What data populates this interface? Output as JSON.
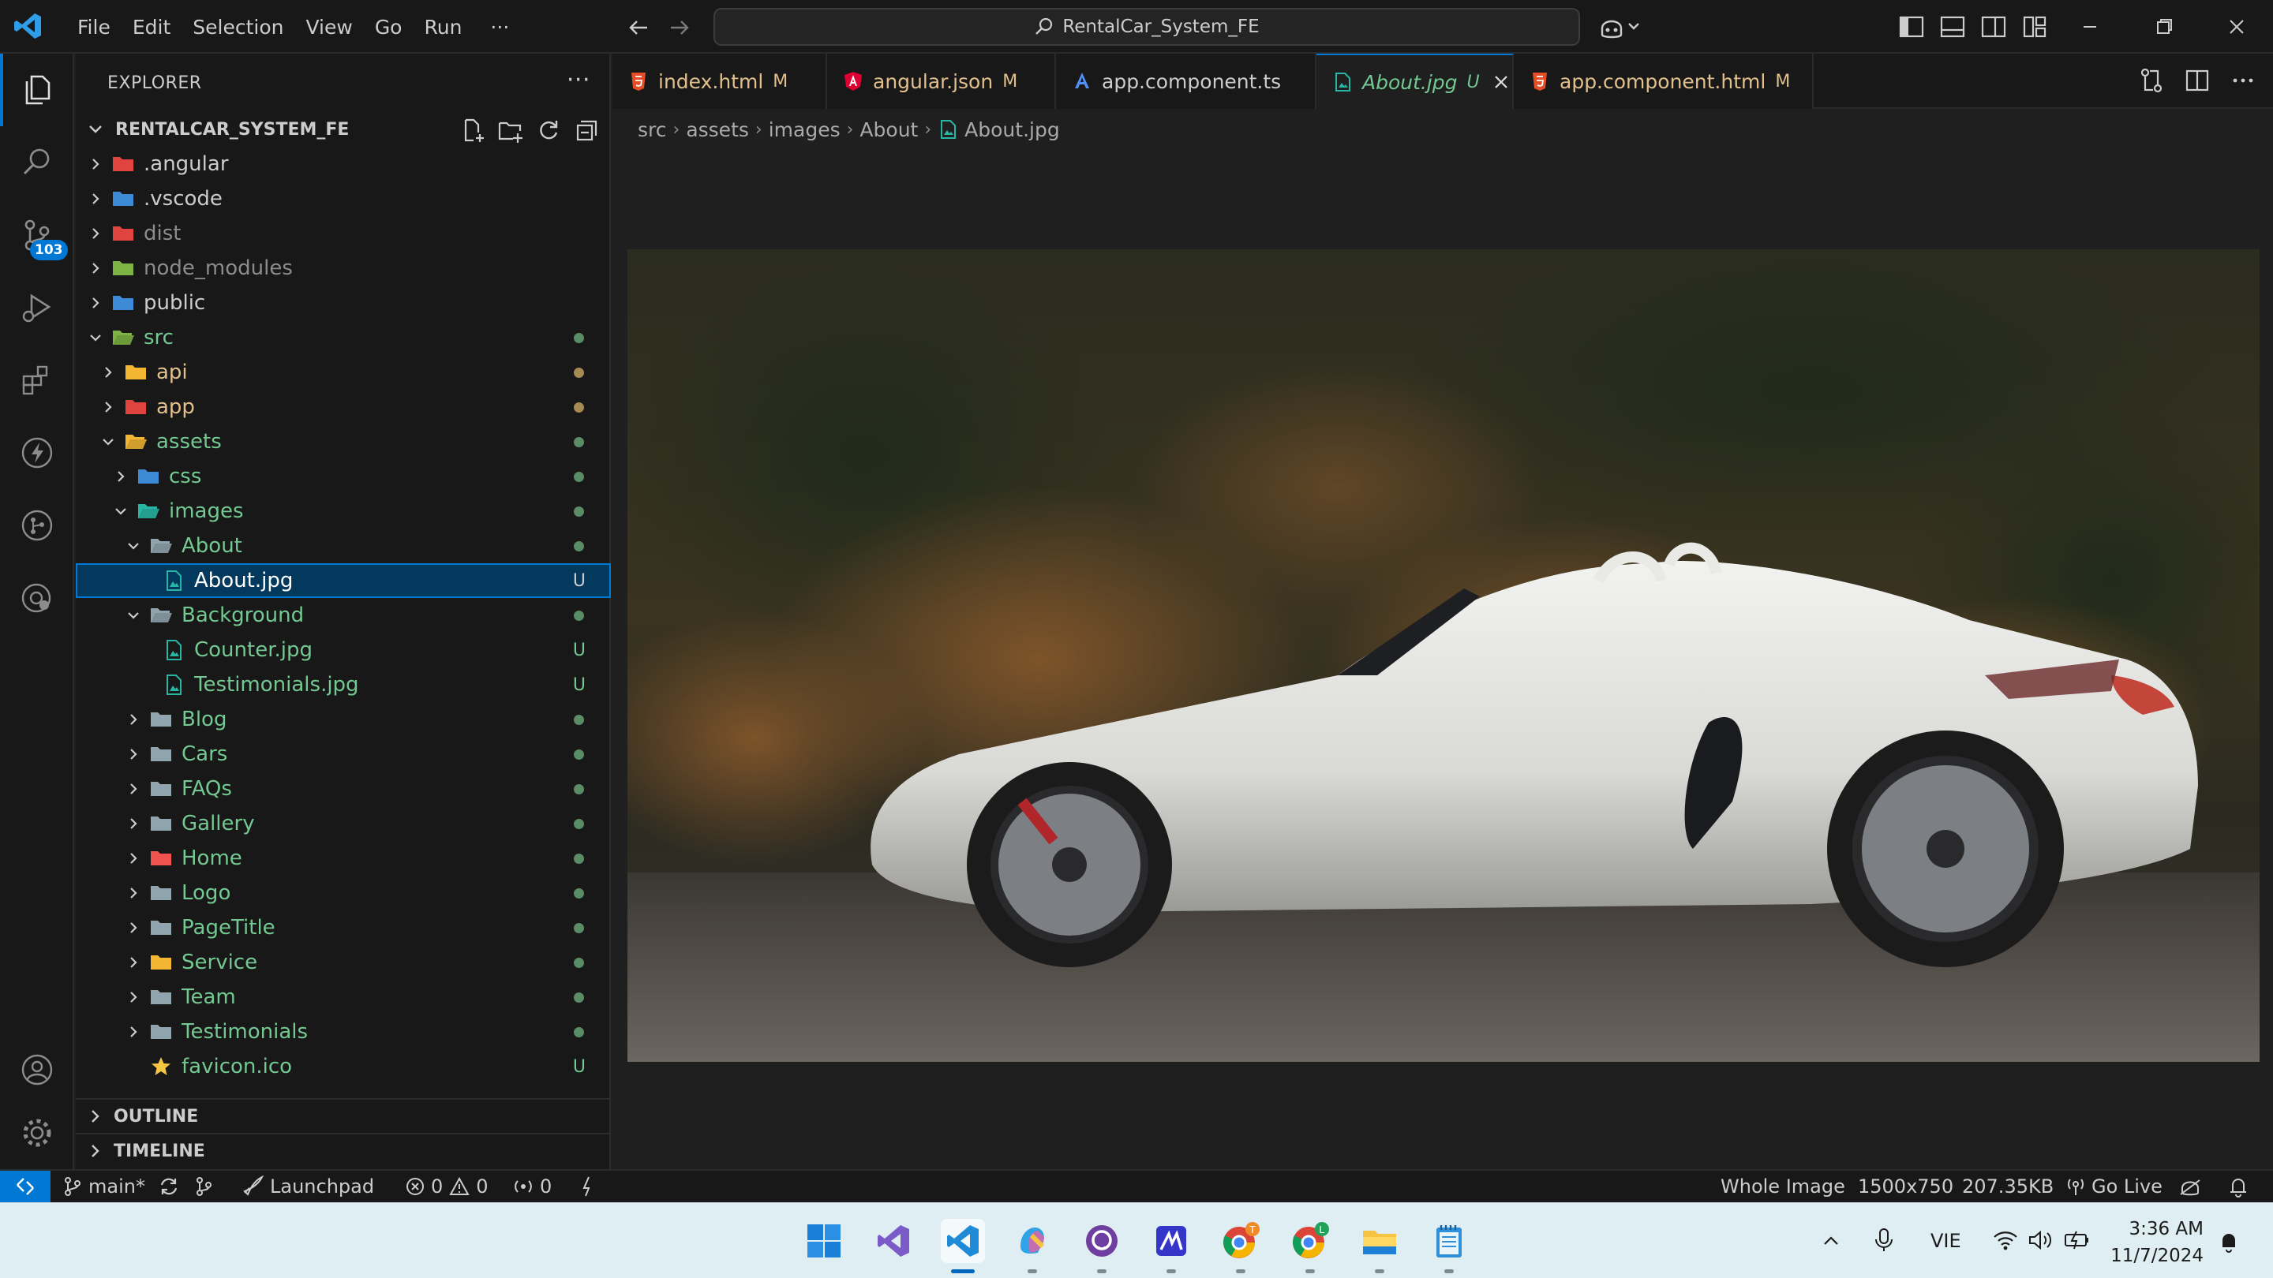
{
  "titlebar": {
    "menu": [
      "File",
      "Edit",
      "Selection",
      "View",
      "Go",
      "Run"
    ],
    "more": "···",
    "search_text": "RentalCar_System_FE"
  },
  "activity": {
    "scm_badge": "103"
  },
  "explorer": {
    "title": "EXPLORER",
    "more": "···",
    "root": "RENTALCAR_SYSTEM_FE",
    "tree": [
      {
        "name": ".angular",
        "depth": 0,
        "state": "collapsed",
        "icon": "angular-folder-icon",
        "tone": "normal",
        "status": "",
        "dot": ""
      },
      {
        "name": ".vscode",
        "depth": 0,
        "state": "collapsed",
        "icon": "vscode-folder-icon",
        "tone": "normal",
        "status": "",
        "dot": ""
      },
      {
        "name": "dist",
        "depth": 0,
        "state": "collapsed",
        "icon": "dist-folder-icon",
        "tone": "dim",
        "status": "",
        "dot": ""
      },
      {
        "name": "node_modules",
        "depth": 0,
        "state": "collapsed",
        "icon": "node-folder-icon",
        "tone": "dim",
        "status": "",
        "dot": ""
      },
      {
        "name": "public",
        "depth": 0,
        "state": "collapsed",
        "icon": "public-folder-icon",
        "tone": "normal",
        "status": "",
        "dot": ""
      },
      {
        "name": "src",
        "depth": 0,
        "state": "expanded",
        "icon": "src-folder-icon",
        "tone": "green",
        "status": "",
        "dot": "green"
      },
      {
        "name": "api",
        "depth": 1,
        "state": "collapsed",
        "icon": "api-folder-icon",
        "tone": "yellow",
        "status": "",
        "dot": "yellow"
      },
      {
        "name": "app",
        "depth": 1,
        "state": "collapsed",
        "icon": "app-folder-icon",
        "tone": "yellow",
        "status": "",
        "dot": "yellow"
      },
      {
        "name": "assets",
        "depth": 1,
        "state": "expanded",
        "icon": "assets-folder-icon",
        "tone": "green",
        "status": "",
        "dot": "green"
      },
      {
        "name": "css",
        "depth": 2,
        "state": "collapsed",
        "icon": "css-folder-icon",
        "tone": "green",
        "status": "",
        "dot": "green"
      },
      {
        "name": "images",
        "depth": 2,
        "state": "expanded",
        "icon": "images-folder-icon",
        "tone": "green",
        "status": "",
        "dot": "green"
      },
      {
        "name": "About",
        "depth": 3,
        "state": "expanded",
        "icon": "folder-open-icon",
        "tone": "green",
        "status": "",
        "dot": "green"
      },
      {
        "name": "About.jpg",
        "depth": 4,
        "state": "file",
        "icon": "image-file-icon",
        "tone": "white",
        "status": "U",
        "dot": "",
        "selected": true
      },
      {
        "name": "Background",
        "depth": 3,
        "state": "expanded",
        "icon": "folder-open-icon",
        "tone": "green",
        "status": "",
        "dot": "green"
      },
      {
        "name": "Counter.jpg",
        "depth": 4,
        "state": "file",
        "icon": "image-file-icon",
        "tone": "green",
        "status": "U",
        "dot": ""
      },
      {
        "name": "Testimonials.jpg",
        "depth": 4,
        "state": "file",
        "icon": "image-file-icon",
        "tone": "green",
        "status": "U",
        "dot": ""
      },
      {
        "name": "Blog",
        "depth": 3,
        "state": "collapsed",
        "icon": "folder-icon",
        "tone": "green",
        "status": "",
        "dot": "green"
      },
      {
        "name": "Cars",
        "depth": 3,
        "state": "collapsed",
        "icon": "folder-icon",
        "tone": "green",
        "status": "",
        "dot": "green"
      },
      {
        "name": "FAQs",
        "depth": 3,
        "state": "collapsed",
        "icon": "folder-icon",
        "tone": "green",
        "status": "",
        "dot": "green"
      },
      {
        "name": "Gallery",
        "depth": 3,
        "state": "collapsed",
        "icon": "folder-icon",
        "tone": "green",
        "status": "",
        "dot": "green"
      },
      {
        "name": "Home",
        "depth": 3,
        "state": "collapsed",
        "icon": "home-folder-icon",
        "tone": "green",
        "status": "",
        "dot": "green"
      },
      {
        "name": "Logo",
        "depth": 3,
        "state": "collapsed",
        "icon": "folder-icon",
        "tone": "green",
        "status": "",
        "dot": "green"
      },
      {
        "name": "PageTitle",
        "depth": 3,
        "state": "collapsed",
        "icon": "folder-icon",
        "tone": "green",
        "status": "",
        "dot": "green"
      },
      {
        "name": "Service",
        "depth": 3,
        "state": "collapsed",
        "icon": "service-folder-icon",
        "tone": "green",
        "status": "",
        "dot": "green"
      },
      {
        "name": "Team",
        "depth": 3,
        "state": "collapsed",
        "icon": "folder-icon",
        "tone": "green",
        "status": "",
        "dot": "green"
      },
      {
        "name": "Testimonials",
        "depth": 3,
        "state": "collapsed",
        "icon": "folder-icon",
        "tone": "green",
        "status": "",
        "dot": "green"
      },
      {
        "name": "favicon.ico",
        "depth": 3,
        "state": "file",
        "icon": "star-file-icon",
        "tone": "green",
        "status": "U",
        "dot": ""
      }
    ],
    "sections": [
      "OUTLINE",
      "TIMELINE"
    ]
  },
  "tabs": [
    {
      "name": "index.html",
      "status": "M",
      "icon": "html-file-icon",
      "active": false
    },
    {
      "name": "angular.json",
      "status": "M",
      "icon": "angular-file-icon",
      "active": false
    },
    {
      "name": "app.component.ts",
      "status": "",
      "icon": "angular-ts-file-icon",
      "active": false
    },
    {
      "name": "About.jpg",
      "status": "U",
      "icon": "image-file-icon",
      "active": true
    },
    {
      "name": "app.component.html",
      "status": "M",
      "icon": "html-file-icon",
      "active": false
    }
  ],
  "breadcrumb": [
    "src",
    "assets",
    "images",
    "About",
    "About.jpg"
  ],
  "statusbar": {
    "branch": "main*",
    "launchpad": "Launchpad",
    "errors": "0",
    "warnings": "0",
    "ports": "0",
    "view_mode": "Whole Image",
    "dimensions": "1500x750",
    "size": "207.35KB",
    "go_live": "Go Live"
  },
  "taskbar": {
    "lang": "VIE",
    "time": "3:36 AM",
    "date": "11/7/2024"
  },
  "colors": {
    "accent": "#0078d4",
    "untracked": "#73c991",
    "modified": "#e2c08d"
  }
}
